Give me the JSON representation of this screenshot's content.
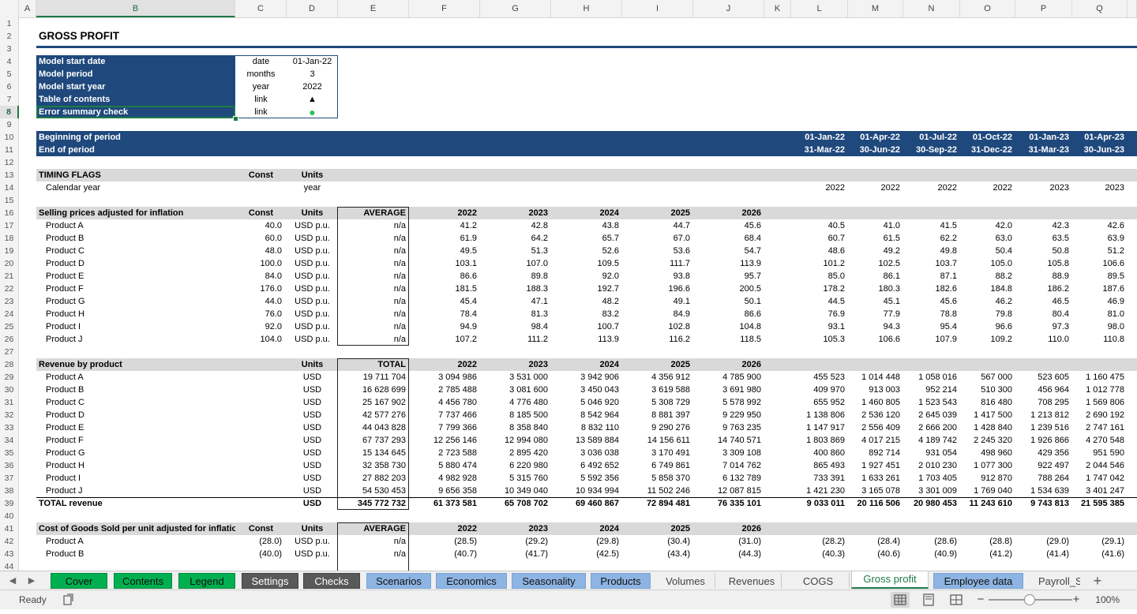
{
  "columns": [
    {
      "key": "A",
      "label": "A"
    },
    {
      "key": "B",
      "label": "B"
    },
    {
      "key": "C",
      "label": "C"
    },
    {
      "key": "D",
      "label": "D"
    },
    {
      "key": "E",
      "label": "E"
    },
    {
      "key": "F",
      "label": "F"
    },
    {
      "key": "G",
      "label": "G"
    },
    {
      "key": "H",
      "label": "H"
    },
    {
      "key": "I",
      "label": "I"
    },
    {
      "key": "J",
      "label": "J"
    },
    {
      "key": "K",
      "label": "K"
    },
    {
      "key": "L",
      "label": "L"
    },
    {
      "key": "M",
      "label": "M"
    },
    {
      "key": "N",
      "label": "N"
    },
    {
      "key": "O",
      "label": "O"
    },
    {
      "key": "P",
      "label": "P"
    },
    {
      "key": "Q",
      "label": "Q"
    }
  ],
  "selected_column": "B",
  "selected_row": 8,
  "row_numbers": [
    "1",
    "2",
    "3",
    "4",
    "5",
    "6",
    "7",
    "8",
    "9",
    "10",
    "11",
    "12",
    "13",
    "14",
    "15",
    "16",
    "17",
    "18",
    "19",
    "20",
    "21",
    "22",
    "23",
    "24",
    "25",
    "26",
    "27",
    "28",
    "29",
    "30",
    "31",
    "32",
    "33",
    "34",
    "35",
    "36",
    "37",
    "38",
    "39",
    "40",
    "41",
    "42",
    "43",
    "44"
  ],
  "colors": {
    "navy": "#1f497d",
    "section_grey": "#d9d9d9",
    "green_tab": "#00b050",
    "grey_tab": "#595959",
    "blue_tab": "#8db4e2",
    "status_green": "#2fbf5b"
  },
  "rows": [
    {
      "n": 2,
      "type": "title",
      "cells": {
        "B": "GROSS PROFIT"
      }
    },
    {
      "n": 4,
      "type": "model",
      "cells": {
        "B": "Model start date",
        "C": "date",
        "D": "01-Jan-22"
      }
    },
    {
      "n": 5,
      "type": "model",
      "cells": {
        "B": "Model period",
        "C": "months",
        "D": "3"
      }
    },
    {
      "n": 6,
      "type": "model",
      "cells": {
        "B": "Model start year",
        "C": "year",
        "D": "2022"
      }
    },
    {
      "n": 7,
      "type": "model",
      "cells": {
        "B": "Table of contents",
        "C": "link",
        "D": "▲"
      }
    },
    {
      "n": 8,
      "type": "model",
      "cells": {
        "B": "Error summary check",
        "C": "link",
        "D": "●"
      }
    },
    {
      "n": 10,
      "type": "period",
      "cells": {
        "B": "Beginning of period",
        "L": "01-Jan-22",
        "M": "01-Apr-22",
        "N": "01-Jul-22",
        "O": "01-Oct-22",
        "P": "01-Jan-23",
        "Q": "01-Apr-23"
      }
    },
    {
      "n": 11,
      "type": "period",
      "cells": {
        "B": "End of period",
        "L": "31-Mar-22",
        "M": "30-Jun-22",
        "N": "30-Sep-22",
        "O": "31-Dec-22",
        "P": "31-Mar-23",
        "Q": "30-Jun-23"
      }
    },
    {
      "n": 13,
      "type": "section",
      "cells": {
        "B": "TIMING FLAGS",
        "C": "Const",
        "D": "Units"
      }
    },
    {
      "n": 14,
      "type": "data",
      "cells": {
        "B": "Calendar year",
        "D": "year",
        "L": "2022",
        "M": "2022",
        "N": "2022",
        "O": "2022",
        "P": "2023",
        "Q": "2023"
      }
    },
    {
      "n": 16,
      "type": "section",
      "cells": {
        "B": "Selling prices adjusted for inflation",
        "C": "Const",
        "D": "Units",
        "E": "AVERAGE",
        "F": "2022",
        "G": "2023",
        "H": "2024",
        "I": "2025",
        "J": "2026"
      }
    },
    {
      "n": 17,
      "type": "data",
      "cells": {
        "B": "Product A",
        "C": "40.0",
        "D": "USD p.u.",
        "E": "n/a",
        "F": "41.2",
        "G": "42.8",
        "H": "43.8",
        "I": "44.7",
        "J": "45.6",
        "L": "40.5",
        "M": "41.0",
        "N": "41.5",
        "O": "42.0",
        "P": "42.3",
        "Q": "42.6"
      }
    },
    {
      "n": 18,
      "type": "data",
      "cells": {
        "B": "Product B",
        "C": "60.0",
        "D": "USD p.u.",
        "E": "n/a",
        "F": "61.9",
        "G": "64.2",
        "H": "65.7",
        "I": "67.0",
        "J": "68.4",
        "L": "60.7",
        "M": "61.5",
        "N": "62.2",
        "O": "63.0",
        "P": "63.5",
        "Q": "63.9"
      }
    },
    {
      "n": 19,
      "type": "data",
      "cells": {
        "B": "Product C",
        "C": "48.0",
        "D": "USD p.u.",
        "E": "n/a",
        "F": "49.5",
        "G": "51.3",
        "H": "52.6",
        "I": "53.6",
        "J": "54.7",
        "L": "48.6",
        "M": "49.2",
        "N": "49.8",
        "O": "50.4",
        "P": "50.8",
        "Q": "51.2"
      }
    },
    {
      "n": 20,
      "type": "data",
      "cells": {
        "B": "Product D",
        "C": "100.0",
        "D": "USD p.u.",
        "E": "n/a",
        "F": "103.1",
        "G": "107.0",
        "H": "109.5",
        "I": "111.7",
        "J": "113.9",
        "L": "101.2",
        "M": "102.5",
        "N": "103.7",
        "O": "105.0",
        "P": "105.8",
        "Q": "106.6"
      }
    },
    {
      "n": 21,
      "type": "data",
      "cells": {
        "B": "Product E",
        "C": "84.0",
        "D": "USD p.u.",
        "E": "n/a",
        "F": "86.6",
        "G": "89.8",
        "H": "92.0",
        "I": "93.8",
        "J": "95.7",
        "L": "85.0",
        "M": "86.1",
        "N": "87.1",
        "O": "88.2",
        "P": "88.9",
        "Q": "89.5"
      }
    },
    {
      "n": 22,
      "type": "data",
      "cells": {
        "B": "Product F",
        "C": "176.0",
        "D": "USD p.u.",
        "E": "n/a",
        "F": "181.5",
        "G": "188.3",
        "H": "192.7",
        "I": "196.6",
        "J": "200.5",
        "L": "178.2",
        "M": "180.3",
        "N": "182.6",
        "O": "184.8",
        "P": "186.2",
        "Q": "187.6"
      }
    },
    {
      "n": 23,
      "type": "data",
      "cells": {
        "B": "Product G",
        "C": "44.0",
        "D": "USD p.u.",
        "E": "n/a",
        "F": "45.4",
        "G": "47.1",
        "H": "48.2",
        "I": "49.1",
        "J": "50.1",
        "L": "44.5",
        "M": "45.1",
        "N": "45.6",
        "O": "46.2",
        "P": "46.5",
        "Q": "46.9"
      }
    },
    {
      "n": 24,
      "type": "data",
      "cells": {
        "B": "Product H",
        "C": "76.0",
        "D": "USD p.u.",
        "E": "n/a",
        "F": "78.4",
        "G": "81.3",
        "H": "83.2",
        "I": "84.9",
        "J": "86.6",
        "L": "76.9",
        "M": "77.9",
        "N": "78.8",
        "O": "79.8",
        "P": "80.4",
        "Q": "81.0"
      }
    },
    {
      "n": 25,
      "type": "data",
      "cells": {
        "B": "Product I",
        "C": "92.0",
        "D": "USD p.u.",
        "E": "n/a",
        "F": "94.9",
        "G": "98.4",
        "H": "100.7",
        "I": "102.8",
        "J": "104.8",
        "L": "93.1",
        "M": "94.3",
        "N": "95.4",
        "O": "96.6",
        "P": "97.3",
        "Q": "98.0"
      }
    },
    {
      "n": 26,
      "type": "data",
      "cells": {
        "B": "Product J",
        "C": "104.0",
        "D": "USD p.u.",
        "E": "n/a",
        "F": "107.2",
        "G": "111.2",
        "H": "113.9",
        "I": "116.2",
        "J": "118.5",
        "L": "105.3",
        "M": "106.6",
        "N": "107.9",
        "O": "109.2",
        "P": "110.0",
        "Q": "110.8"
      }
    },
    {
      "n": 28,
      "type": "section",
      "cells": {
        "B": "Revenue by product",
        "D": "Units",
        "E": "TOTAL",
        "F": "2022",
        "G": "2023",
        "H": "2024",
        "I": "2025",
        "J": "2026"
      }
    },
    {
      "n": 29,
      "type": "data",
      "cells": {
        "B": "Product A",
        "D": "USD",
        "E": "19 711 704",
        "F": "3 094 986",
        "G": "3 531 000",
        "H": "3 942 906",
        "I": "4 356 912",
        "J": "4 785 900",
        "L": "455 523",
        "M": "1 014 448",
        "N": "1 058 016",
        "O": "567 000",
        "P": "523 605",
        "Q": "1 160 475"
      }
    },
    {
      "n": 30,
      "type": "data",
      "cells": {
        "B": "Product B",
        "D": "USD",
        "E": "16 628 699",
        "F": "2 785 488",
        "G": "3 081 600",
        "H": "3 450 043",
        "I": "3 619 588",
        "J": "3 691 980",
        "L": "409 970",
        "M": "913 003",
        "N": "952 214",
        "O": "510 300",
        "P": "456 964",
        "Q": "1 012 778"
      }
    },
    {
      "n": 31,
      "type": "data",
      "cells": {
        "B": "Product C",
        "D": "USD",
        "E": "25 167 902",
        "F": "4 456 780",
        "G": "4 776 480",
        "H": "5 046 920",
        "I": "5 308 729",
        "J": "5 578 992",
        "L": "655 952",
        "M": "1 460 805",
        "N": "1 523 543",
        "O": "816 480",
        "P": "708 295",
        "Q": "1 569 806"
      }
    },
    {
      "n": 32,
      "type": "data",
      "cells": {
        "B": "Product D",
        "D": "USD",
        "E": "42 577 276",
        "F": "7 737 466",
        "G": "8 185 500",
        "H": "8 542 964",
        "I": "8 881 397",
        "J": "9 229 950",
        "L": "1 138 806",
        "M": "2 536 120",
        "N": "2 645 039",
        "O": "1 417 500",
        "P": "1 213 812",
        "Q": "2 690 192"
      }
    },
    {
      "n": 33,
      "type": "data",
      "cells": {
        "B": "Product E",
        "D": "USD",
        "E": "44 043 828",
        "F": "7 799 366",
        "G": "8 358 840",
        "H": "8 832 110",
        "I": "9 290 276",
        "J": "9 763 235",
        "L": "1 147 917",
        "M": "2 556 409",
        "N": "2 666 200",
        "O": "1 428 840",
        "P": "1 239 516",
        "Q": "2 747 161"
      }
    },
    {
      "n": 34,
      "type": "data",
      "cells": {
        "B": "Product F",
        "D": "USD",
        "E": "67 737 293",
        "F": "12 256 146",
        "G": "12 994 080",
        "H": "13 589 884",
        "I": "14 156 611",
        "J": "14 740 571",
        "L": "1 803 869",
        "M": "4 017 215",
        "N": "4 189 742",
        "O": "2 245 320",
        "P": "1 926 866",
        "Q": "4 270 548"
      }
    },
    {
      "n": 35,
      "type": "data",
      "cells": {
        "B": "Product G",
        "D": "USD",
        "E": "15 134 645",
        "F": "2 723 588",
        "G": "2 895 420",
        "H": "3 036 038",
        "I": "3 170 491",
        "J": "3 309 108",
        "L": "400 860",
        "M": "892 714",
        "N": "931 054",
        "O": "498 960",
        "P": "429 356",
        "Q": "951 590"
      }
    },
    {
      "n": 36,
      "type": "data",
      "cells": {
        "B": "Product H",
        "D": "USD",
        "E": "32 358 730",
        "F": "5 880 474",
        "G": "6 220 980",
        "H": "6 492 652",
        "I": "6 749 861",
        "J": "7 014 762",
        "L": "865 493",
        "M": "1 927 451",
        "N": "2 010 230",
        "O": "1 077 300",
        "P": "922 497",
        "Q": "2 044 546"
      }
    },
    {
      "n": 37,
      "type": "data",
      "cells": {
        "B": "Product I",
        "D": "USD",
        "E": "27 882 203",
        "F": "4 982 928",
        "G": "5 315 760",
        "H": "5 592 356",
        "I": "5 858 370",
        "J": "6 132 789",
        "L": "733 391",
        "M": "1 633 261",
        "N": "1 703 405",
        "O": "912 870",
        "P": "788 264",
        "Q": "1 747 042"
      }
    },
    {
      "n": 38,
      "type": "data",
      "cells": {
        "B": "Product J",
        "D": "USD",
        "E": "54 530 453",
        "F": "9 656 358",
        "G": "10 349 040",
        "H": "10 934 994",
        "I": "11 502 246",
        "J": "12 087 815",
        "L": "1 421 230",
        "M": "3 165 078",
        "N": "3 301 009",
        "O": "1 769 040",
        "P": "1 534 639",
        "Q": "3 401 247"
      }
    },
    {
      "n": 39,
      "type": "total",
      "cells": {
        "B": "TOTAL revenue",
        "D": "USD",
        "E": "345 772 732",
        "F": "61 373 581",
        "G": "65 708 702",
        "H": "69 460 867",
        "I": "72 894 481",
        "J": "76 335 101",
        "L": "9 033 011",
        "M": "20 116 506",
        "N": "20 980 453",
        "O": "11 243 610",
        "P": "9 743 813",
        "Q": "21 595 385"
      }
    },
    {
      "n": 41,
      "type": "section",
      "cells": {
        "B": "Cost of Goods Sold per unit adjusted for inflation",
        "C": "Const",
        "D": "Units",
        "E": "AVERAGE",
        "F": "2022",
        "G": "2023",
        "H": "2024",
        "I": "2025",
        "J": "2026"
      }
    },
    {
      "n": 42,
      "type": "data",
      "cells": {
        "B": "Product A",
        "C": "(28.0)",
        "D": "USD p.u.",
        "E": "n/a",
        "F": "(28.5)",
        "G": "(29.2)",
        "H": "(29.8)",
        "I": "(30.4)",
        "J": "(31.0)",
        "L": "(28.2)",
        "M": "(28.4)",
        "N": "(28.6)",
        "O": "(28.8)",
        "P": "(29.0)",
        "Q": "(29.1)"
      }
    },
    {
      "n": 43,
      "type": "data",
      "cells": {
        "B": "Product B",
        "C": "(40.0)",
        "D": "USD p.u.",
        "E": "n/a",
        "F": "(40.7)",
        "G": "(41.7)",
        "H": "(42.5)",
        "I": "(43.4)",
        "J": "(44.3)",
        "L": "(40.3)",
        "M": "(40.6)",
        "N": "(40.9)",
        "O": "(41.2)",
        "P": "(41.4)",
        "Q": "(41.6)"
      }
    }
  ],
  "sheet_tabs": [
    {
      "label": "Cover",
      "style": "green"
    },
    {
      "label": "Contents",
      "style": "green"
    },
    {
      "label": "Legend",
      "style": "green"
    },
    {
      "label": "Settings",
      "style": "grey"
    },
    {
      "label": "Checks",
      "style": "grey"
    },
    {
      "label": "Scenarios",
      "style": "blue"
    },
    {
      "label": "Economics",
      "style": "blue"
    },
    {
      "label": "Seasonality",
      "style": "blue"
    },
    {
      "label": "Products",
      "style": "blue"
    },
    {
      "label": "Volumes",
      "style": "plain"
    },
    {
      "label": "Revenues",
      "style": "plain"
    },
    {
      "label": "COGS",
      "style": "plain"
    },
    {
      "label": "Gross profit",
      "style": "active"
    },
    {
      "label": "Employee data",
      "style": "blue"
    },
    {
      "label": "Payroll_S",
      "style": "plain"
    }
  ],
  "add_sheet_label": "+",
  "status": {
    "ready": "Ready",
    "zoom": "100%",
    "zoom_minus": "−",
    "zoom_plus": "+",
    "zoom_level_percent": 100
  },
  "icons": {
    "prev_sheet": "chevron-left-icon",
    "next_sheet": "chevron-right-icon",
    "accessibility": "accessibility-icon",
    "normal_view": "normal-view-icon",
    "page_layout": "page-layout-icon",
    "page_break": "page-break-preview-icon"
  }
}
